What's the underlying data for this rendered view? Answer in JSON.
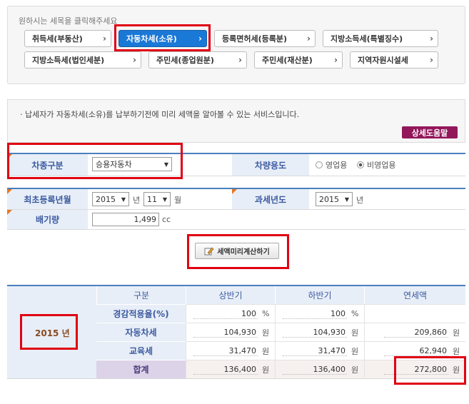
{
  "tax_select": {
    "hint": "원하시는 세목을 클릭해주세요",
    "buttons": [
      {
        "label": "취득세(부동산)"
      },
      {
        "label": "자동차세(소유)",
        "active": true
      },
      {
        "label": "등록면허세(등록분)"
      },
      {
        "label": "지방소득세(특별징수)"
      },
      {
        "label": "지방소득세(법인세분)"
      },
      {
        "label": "주민세(종업원분)"
      },
      {
        "label": "주민세(재산분)"
      },
      {
        "label": "지역자원시설세"
      }
    ],
    "chevron": "›"
  },
  "info": {
    "text": "· 납세자가 자동차세(소유)를 납부하기전에 미리 세액을 알아볼 수 있는 서비스입니다.",
    "help_button": "상세도움말"
  },
  "form": {
    "vehicle_type_label": "차종구분",
    "vehicle_type_value": "승용자동차",
    "vehicle_use_label": "차량용도",
    "use_options": [
      {
        "label": "영업용",
        "selected": false
      },
      {
        "label": "비영업용",
        "selected": true
      }
    ],
    "first_reg_label": "최초등록년월",
    "reg_year": "2015",
    "year_unit": "년",
    "reg_month": "11",
    "month_unit": "월",
    "tax_year_label": "과세년도",
    "tax_year": "2015",
    "tax_year_unit": "년",
    "displacement_label": "배기량",
    "displacement_value": "1,499",
    "displacement_unit": "cc",
    "calc_button": "세액미리계산하기"
  },
  "result": {
    "year_label": "2015 년",
    "headers": [
      "구분",
      "상반기",
      "하반기",
      "연세액"
    ],
    "rows": [
      {
        "label": "경감적용율(%)",
        "first": "100",
        "first_unit": "%",
        "second": "100",
        "second_unit": "%",
        "annual": "",
        "annual_unit": ""
      },
      {
        "label": "자동차세",
        "first": "104,930",
        "first_unit": "원",
        "second": "104,930",
        "second_unit": "원",
        "annual": "209,860",
        "annual_unit": "원"
      },
      {
        "label": "교육세",
        "first": "31,470",
        "first_unit": "원",
        "second": "31,470",
        "second_unit": "원",
        "annual": "62,940",
        "annual_unit": "원"
      },
      {
        "label": "합계",
        "first": "136,400",
        "first_unit": "원",
        "second": "136,400",
        "second_unit": "원",
        "annual": "272,800",
        "annual_unit": "원"
      }
    ]
  },
  "colors": {
    "accent_blue": "#1a78d6",
    "highlight_red": "#e00012",
    "help_purple": "#93175b",
    "label_bg": "#e8eef7"
  }
}
